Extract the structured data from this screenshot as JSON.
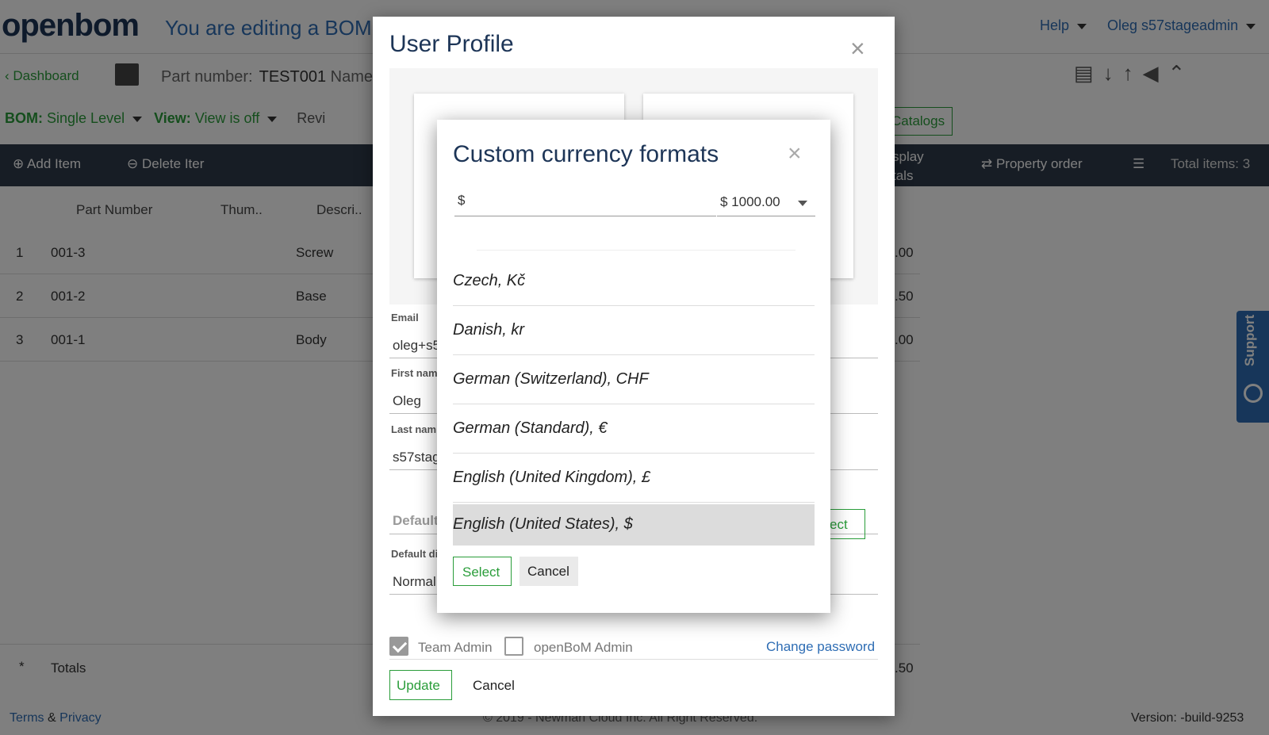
{
  "app": {
    "logo": "openbom",
    "editing_banner": "You are editing a BOM",
    "help": "Help",
    "user": "Oleg s57stageadmin",
    "dashboard": "Dashboard",
    "part_number_label": "Part number:",
    "part_number_value": "TEST001",
    "name_label": "Name",
    "bom_label": "BOM:",
    "bom_value": "Single Level",
    "view_label": "View:",
    "view_value": "View is off",
    "revisions": "Revi",
    "catalogs": "Catalogs",
    "toolbar": {
      "add_item": "Add Item",
      "delete_item": "Delete Iter",
      "display_totals_1": "splay",
      "display_totals_2": "tals",
      "property_order": "Property order",
      "total_items": "Total items: 3"
    },
    "grid": {
      "headers": [
        "Part Number",
        "Thum..",
        "Descri.."
      ],
      "rows": [
        {
          "n": "1",
          "part": "001-3",
          "desc": "Screw",
          "tail": ".00"
        },
        {
          "n": "2",
          "part": "001-2",
          "desc": "Base",
          "tail": ".50"
        },
        {
          "n": "3",
          "part": "001-1",
          "desc": "Body",
          "tail": ".00"
        }
      ],
      "totals_label": "Totals",
      "totals_tail": ".50",
      "totals_marker": "*"
    },
    "footer": {
      "terms": "Terms",
      "amp": "&",
      "privacy": "Privacy",
      "copyright": "© 2019 - Newman Cloud Inc. All Right Reserved.",
      "version": "Version: -build-9253"
    },
    "support": "Support"
  },
  "profile": {
    "title": "User Profile",
    "email_label": "Email",
    "email_value": "oleg+s5",
    "first_label": "First nam",
    "first_value": "Oleg",
    "last_label": "Last nam",
    "last_value": "s57stag",
    "default_placeholder": "Default",
    "default_select": "ect",
    "default_di_label": "Default di",
    "default_di_value": "Normal",
    "team_admin": "Team Admin",
    "openbom_admin": "openBoM Admin",
    "change_password": "Change password",
    "update": "Update",
    "cancel": "Cancel"
  },
  "currency_modal": {
    "title": "Custom currency formats",
    "symbol_input": "$",
    "format_select": "$ 1000.00",
    "options": [
      "Czech, Kč",
      "Danish, kr",
      "German (Switzerland), CHF",
      "German (Standard), €",
      "English (United Kingdom), £",
      "English (United States), $"
    ],
    "selected_index": 5,
    "select_button": "Select",
    "cancel_button": "Cancel"
  }
}
